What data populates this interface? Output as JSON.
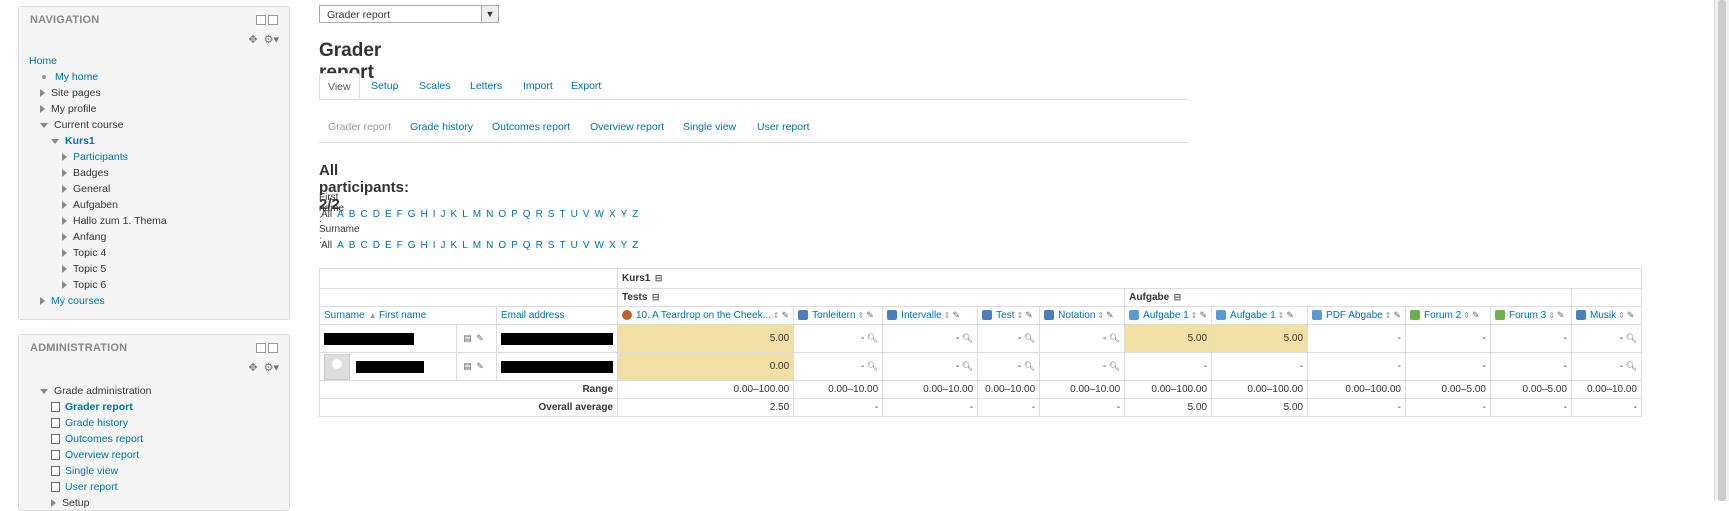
{
  "navigation": {
    "title": "NAVIGATION",
    "items": [
      {
        "label": "Home",
        "type": "link",
        "indent": 0,
        "marker": "none"
      },
      {
        "label": "My home",
        "type": "link",
        "indent": 1,
        "marker": "dot"
      },
      {
        "label": "Site pages",
        "type": "text",
        "indent": 1,
        "marker": "right"
      },
      {
        "label": "My profile",
        "type": "text",
        "indent": 1,
        "marker": "right"
      },
      {
        "label": "Current course",
        "type": "text",
        "indent": 1,
        "marker": "down"
      },
      {
        "label": "Kurs1",
        "type": "link-bold",
        "indent": 2,
        "marker": "down"
      },
      {
        "label": "Participants",
        "type": "link",
        "indent": 3,
        "marker": "right"
      },
      {
        "label": "Badges",
        "type": "text",
        "indent": 3,
        "marker": "right"
      },
      {
        "label": "General",
        "type": "text",
        "indent": 3,
        "marker": "right"
      },
      {
        "label": "Aufgaben",
        "type": "text",
        "indent": 3,
        "marker": "right"
      },
      {
        "label": "Hallo zum 1. Thema",
        "type": "text",
        "indent": 3,
        "marker": "right"
      },
      {
        "label": "Anfang",
        "type": "text",
        "indent": 3,
        "marker": "right"
      },
      {
        "label": "Topic 4",
        "type": "text",
        "indent": 3,
        "marker": "right"
      },
      {
        "label": "Topic 5",
        "type": "text",
        "indent": 3,
        "marker": "right"
      },
      {
        "label": "Topic 6",
        "type": "text",
        "indent": 3,
        "marker": "right"
      },
      {
        "label": "My courses",
        "type": "link",
        "indent": 1,
        "marker": "right"
      }
    ]
  },
  "administration": {
    "title": "ADMINISTRATION",
    "items": [
      {
        "label": "Grade administration",
        "type": "text",
        "indent": 1,
        "marker": "down"
      },
      {
        "label": "Grader report",
        "type": "link-bold",
        "indent": 2,
        "marker": "page"
      },
      {
        "label": "Grade history",
        "type": "link",
        "indent": 2,
        "marker": "page"
      },
      {
        "label": "Outcomes report",
        "type": "link",
        "indent": 2,
        "marker": "page"
      },
      {
        "label": "Overview report",
        "type": "link",
        "indent": 2,
        "marker": "page"
      },
      {
        "label": "Single view",
        "type": "link",
        "indent": 2,
        "marker": "page"
      },
      {
        "label": "User report",
        "type": "link",
        "indent": 2,
        "marker": "page"
      },
      {
        "label": "Setup",
        "type": "text",
        "indent": 2,
        "marker": "right"
      }
    ]
  },
  "report_select": {
    "value": "Grader report"
  },
  "page_title": "Grader report",
  "tabs": [
    "View",
    "Setup",
    "Scales",
    "Letters",
    "Import",
    "Export"
  ],
  "subtabs": [
    "Grader report",
    "Grade history",
    "Outcomes report",
    "Overview report",
    "Single view",
    "User report"
  ],
  "participants_heading": "All participants: 2/2",
  "firstname_label": "First name :",
  "surname_label": "Surname :",
  "letters": [
    "All",
    "A",
    "B",
    "C",
    "D",
    "E",
    "F",
    "G",
    "H",
    "I",
    "J",
    "K",
    "L",
    "M",
    "N",
    "O",
    "P",
    "Q",
    "R",
    "S",
    "T",
    "U",
    "V",
    "W",
    "X",
    "Y",
    "Z"
  ],
  "table": {
    "course_cat": "Kurs1",
    "tests_cat": "Tests",
    "aufgabe_cat": "Aufgabe",
    "surname_header": "Surname",
    "firstname_header": "First name",
    "email_header": "Email address",
    "columns": [
      {
        "label": "10. A Teardrop on the Cheek...",
        "icon": "lesson",
        "hl": true
      },
      {
        "label": "Tonleitern",
        "icon": "quiz",
        "hl": false
      },
      {
        "label": "Intervalle",
        "icon": "quiz",
        "hl": false
      },
      {
        "label": "Test",
        "icon": "quiz",
        "hl": false
      },
      {
        "label": "Notation",
        "icon": "quiz",
        "hl": false
      },
      {
        "label": "Aufgabe 1",
        "icon": "assign",
        "hl": true
      },
      {
        "label": "Aufgabe 1",
        "icon": "assign",
        "hl": true
      },
      {
        "label": "PDF Abgabe",
        "icon": "assign",
        "hl": false
      },
      {
        "label": "Forum 2",
        "icon": "forum",
        "hl": false
      },
      {
        "label": "Forum 3",
        "icon": "forum",
        "hl": false
      },
      {
        "label": "Musik",
        "icon": "quiz",
        "hl": false
      }
    ],
    "rows": [
      {
        "values": [
          "5.00",
          "-",
          "-",
          "-",
          "-",
          "5.00",
          "5.00",
          "-",
          "-",
          "-",
          "-"
        ]
      },
      {
        "values": [
          "0.00",
          "-",
          "-",
          "-",
          "-",
          "-",
          "-",
          "-",
          "-",
          "-",
          "-"
        ]
      }
    ],
    "range_label": "Range",
    "ranges": [
      "0.00–100.00",
      "0.00–10.00",
      "0.00–10.00",
      "0.00–10.00",
      "0.00–10.00",
      "0.00–100.00",
      "0.00–100.00",
      "0.00–100.00",
      "0.00–5.00",
      "0.00–5.00",
      "0.00–10.00"
    ],
    "avg_label": "Overall average",
    "averages": [
      "2.50",
      "-",
      "-",
      "-",
      "-",
      "5.00",
      "5.00",
      "-",
      "-",
      "-",
      "-"
    ]
  }
}
